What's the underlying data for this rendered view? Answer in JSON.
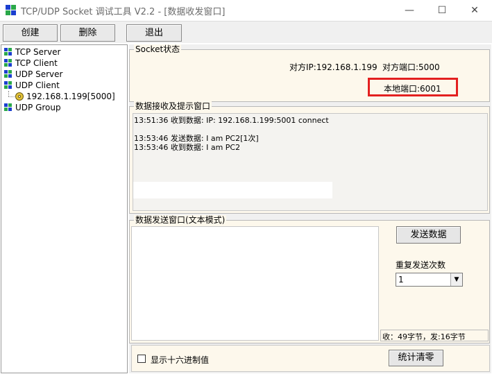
{
  "window": {
    "title": "TCP/UDP Socket 调试工具 V2.2 - [数据收发窗口]",
    "minimize_glyph": "—",
    "maximize_glyph": "☐",
    "close_glyph": "✕"
  },
  "toolbar": {
    "create_label": "创建",
    "delete_label": "删除",
    "exit_label": "退出"
  },
  "tree": {
    "items": [
      {
        "label": "TCP Server"
      },
      {
        "label": "TCP Client"
      },
      {
        "label": "UDP Server"
      },
      {
        "label": "UDP Client"
      },
      {
        "label": "192.168.1.199[5000]"
      },
      {
        "label": "UDP Group"
      }
    ]
  },
  "status": {
    "group_title": "Socket状态",
    "remote_ip": "对方IP:192.168.1.199",
    "remote_port": "对方端口:5000",
    "local_port": "本地端口:6001"
  },
  "receive": {
    "group_title": "数据接收及提示窗口",
    "lines": [
      "13:51:36 收到数据:  IP: 192.168.1.199:5001 connect",
      "",
      "13:53:46 发送数据:  I am PC2[1次]",
      "13:53:46 收到数据:  I am PC2"
    ]
  },
  "send": {
    "group_title": "数据发送窗口(文本模式)",
    "send_button": "发送数据",
    "repeat_label": "重复发送次数",
    "repeat_value": "1",
    "stats": "收：49字节，发:16字节",
    "hex_label": "显示十六进制值",
    "reset_button": "统计清零"
  },
  "colors": {
    "panel_bg": "#fdf8ec",
    "highlight": "#e32020",
    "icon_blue": "#1b3fcf",
    "icon_green": "#2aa84a"
  }
}
